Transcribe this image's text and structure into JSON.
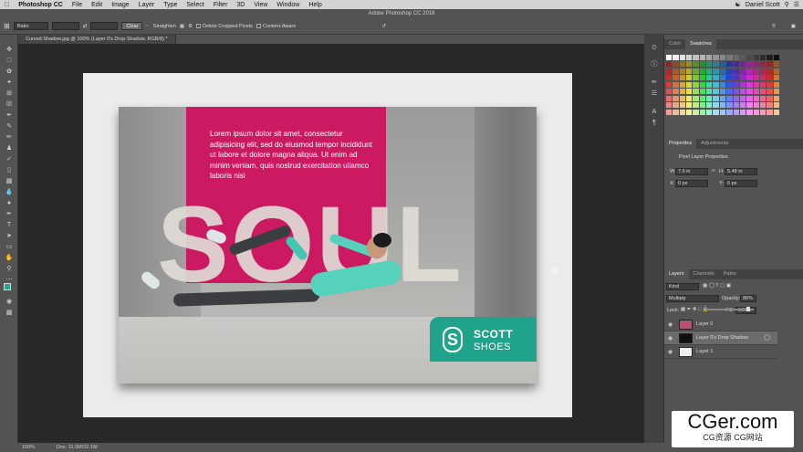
{
  "menubar": {
    "app": "Photoshop CC",
    "items": [
      "File",
      "Edit",
      "Image",
      "Layer",
      "Type",
      "Select",
      "Filter",
      "3D",
      "View",
      "Window",
      "Help"
    ],
    "user": "Daniel Scott"
  },
  "titlebar": {
    "title": "Adobe Photoshop CC 2018"
  },
  "options": {
    "ratio": "Ratio",
    "clear": "Clear",
    "straighten": "Straighten",
    "delete_cropped": "Delete Cropped Pixels",
    "content_aware": "Content-Aware"
  },
  "document": {
    "tab": "Curved Shadow.jpg @ 100% (Layer 0's Drop Shadow, RGB/8) *"
  },
  "artwork": {
    "lorem": "Lorem ipsum dolor sit amet, consectetur adipisicing elit, sed do eiusmod tempor incididunt ut labore et dolore magna aliqua. Ut enim ad minim veniam, quis nostrud exercitation ullamco laboris nisi",
    "headline": "SOUL",
    "brand_top": "SCOTT",
    "brand_bottom": "SHOES"
  },
  "status": {
    "zoom": "100%",
    "doc": "Doc: 11.0M/22.1M"
  },
  "panels": {
    "color_tabs": [
      "Color",
      "Swatches"
    ],
    "props_tabs": [
      "Properties",
      "Adjustments"
    ],
    "props_title": "Pixel Layer Properties",
    "w_label": "W:",
    "w_value": "7.6 in",
    "h_label": "H:",
    "h_value": "5.48 in",
    "x_label": "X:",
    "x_value": "0 px",
    "y_label": "Y:",
    "y_value": "0 px",
    "layers_tabs": [
      "Layers",
      "Channels",
      "Paths"
    ],
    "kind": "Kind",
    "blend": "Multiply",
    "opacity_label": "Opacity:",
    "opacity": "86%",
    "lock_label": "Lock:",
    "fill_label": "Fill:",
    "fill": "100%",
    "layers": [
      "Layer 0",
      "Layer 0's Drop Shadow",
      "Layer 1"
    ]
  },
  "watermark": {
    "top": "CGer.com",
    "bottom": "CG资源 CG网站"
  },
  "colors": {
    "accent_pink": "#cc1a62",
    "brand_teal": "#1fa48b",
    "ui_gray": "#535353"
  }
}
